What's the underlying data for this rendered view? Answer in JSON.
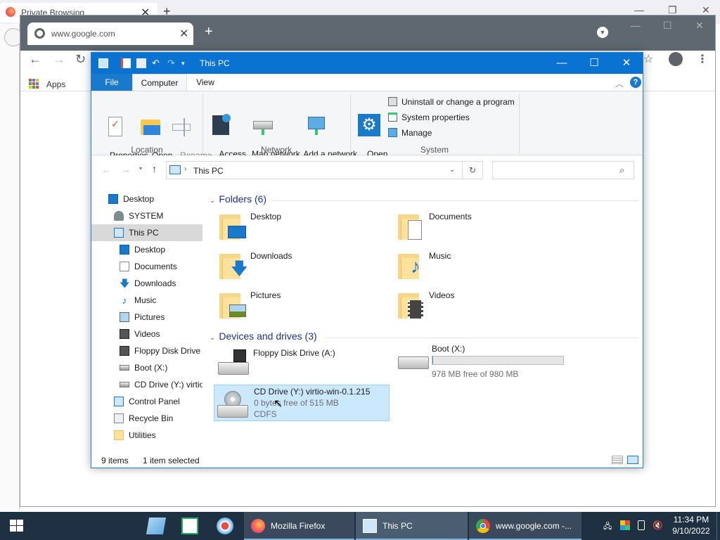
{
  "firefox": {
    "tab_title": "Private Browsing"
  },
  "chrome": {
    "tab_title": "www.google.com",
    "bookmarks_apps": "Apps"
  },
  "explorer": {
    "title": "This PC",
    "menu_tabs": {
      "file": "File",
      "computer": "Computer",
      "view": "View"
    },
    "ribbon": {
      "properties": "Properties",
      "open": "Open",
      "rename": "Rename",
      "access_media": "Access\nmedia ▾",
      "map_network_drive": "Map network\ndrive ▾",
      "add_network_location": "Add a network\nlocation",
      "open_settings": "Open\nSettings",
      "uninstall": "Uninstall or change a program",
      "system_properties": "System properties",
      "manage": "Manage",
      "group_location": "Location",
      "group_network": "Network",
      "group_system": "System"
    },
    "address": {
      "path": "This PC"
    },
    "tree": [
      {
        "label": "Desktop"
      },
      {
        "label": "SYSTEM"
      },
      {
        "label": "This PC"
      },
      {
        "label": "Desktop"
      },
      {
        "label": "Documents"
      },
      {
        "label": "Downloads"
      },
      {
        "label": "Music"
      },
      {
        "label": "Pictures"
      },
      {
        "label": "Videos"
      },
      {
        "label": "Floppy Disk Drive"
      },
      {
        "label": "Boot (X:)"
      },
      {
        "label": "CD Drive (Y:) virtio"
      },
      {
        "label": "Control Panel"
      },
      {
        "label": "Recycle Bin"
      },
      {
        "label": "Utilities"
      }
    ],
    "folders_header": "Folders (6)",
    "folders": [
      {
        "label": "Desktop"
      },
      {
        "label": "Documents"
      },
      {
        "label": "Downloads"
      },
      {
        "label": "Music"
      },
      {
        "label": "Pictures"
      },
      {
        "label": "Videos"
      }
    ],
    "devices_header": "Devices and drives (3)",
    "drives": {
      "floppy": {
        "label": "Floppy Disk Drive (A:)"
      },
      "boot": {
        "label": "Boot (X:)",
        "free": "978 MB free of 980 MB",
        "used_fraction": 0.002
      },
      "cd": {
        "label": "CD Drive (Y:) virtio-win-0.1.215",
        "free": "0 bytes free of 515 MB",
        "fs": "CDFS"
      }
    },
    "status": {
      "items": "9 items",
      "selected": "1 item selected"
    }
  },
  "taskbar": {
    "firefox": "Mozilla Firefox",
    "this_pc": "This PC",
    "chrome": "www.google.com -...",
    "time": "11:34 PM",
    "date": "9/10/2022"
  }
}
